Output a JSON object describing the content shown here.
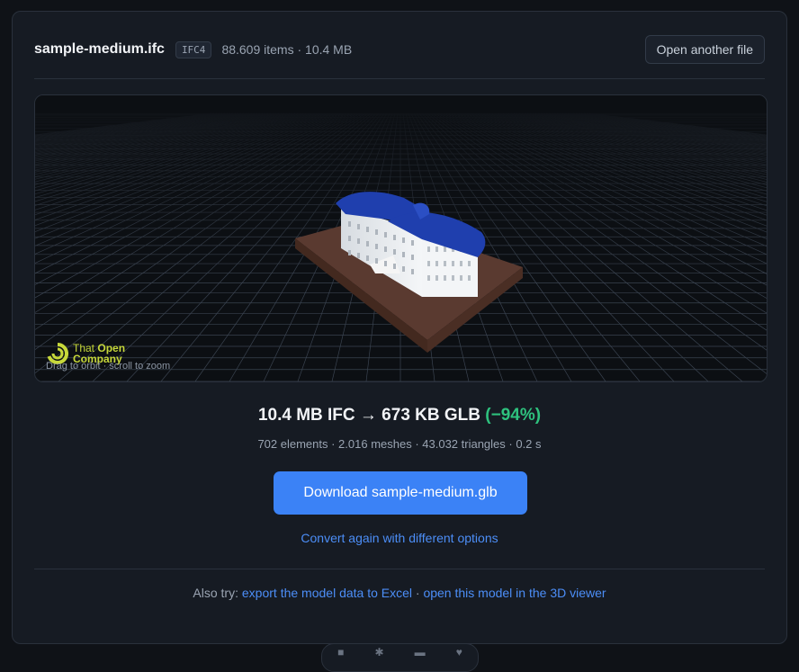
{
  "header": {
    "file_name": "sample-medium.ifc",
    "schema_badge": "IFC4",
    "meta": "88.609 items · 10.4 MB",
    "open_button": "Open another file"
  },
  "viewer": {
    "logo_line1_a": "That ",
    "logo_line1_b": "Open",
    "logo_line2": "Company",
    "hint": "Drag to orbit · scroll to zoom",
    "colors": {
      "background": "#0c0f13",
      "grid": "#3a4350",
      "base": "#5a3a30",
      "roof": "#1f3fae",
      "walls": "#e8ecef"
    }
  },
  "result": {
    "conversion": "10.4 MB IFC → 673 KB GLB ",
    "reduction": "(−94%)",
    "details": "702 elements · 2.016 meshes · 43.032 triangles · 0.2 s",
    "download_button": "Download sample-medium.glb",
    "convert_again": "Convert again with different options"
  },
  "also": {
    "prefix": "Also try: ",
    "link_excel": "export the model data to Excel",
    "separator": " · ",
    "link_viewer": "open this model in the 3D viewer"
  },
  "colors": {
    "accent": "#3b82f6",
    "success": "#2ec27e",
    "logo": "#c7d83a"
  }
}
